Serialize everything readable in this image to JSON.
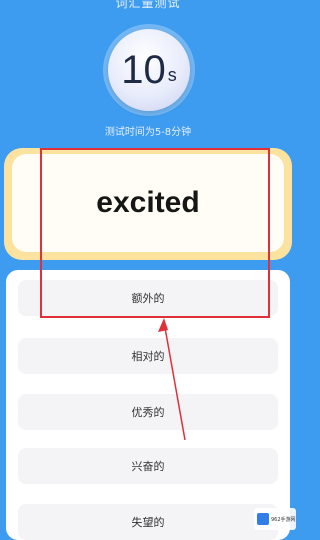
{
  "header": {
    "title": "词汇量测试"
  },
  "timer": {
    "value": "10",
    "unit": "s"
  },
  "subtitle": "测试时间为5-8分钟",
  "question": {
    "word": "excited"
  },
  "options": [
    {
      "label": "额外的"
    },
    {
      "label": "相对的"
    },
    {
      "label": "优秀的"
    },
    {
      "label": "兴奋的"
    },
    {
      "label": "失望的"
    }
  ],
  "annotation": {
    "color": "#e0303a"
  },
  "watermark": {
    "text": "962手游网"
  },
  "colors": {
    "background": "#3d9bf0",
    "card_border": "#fbe39f"
  }
}
